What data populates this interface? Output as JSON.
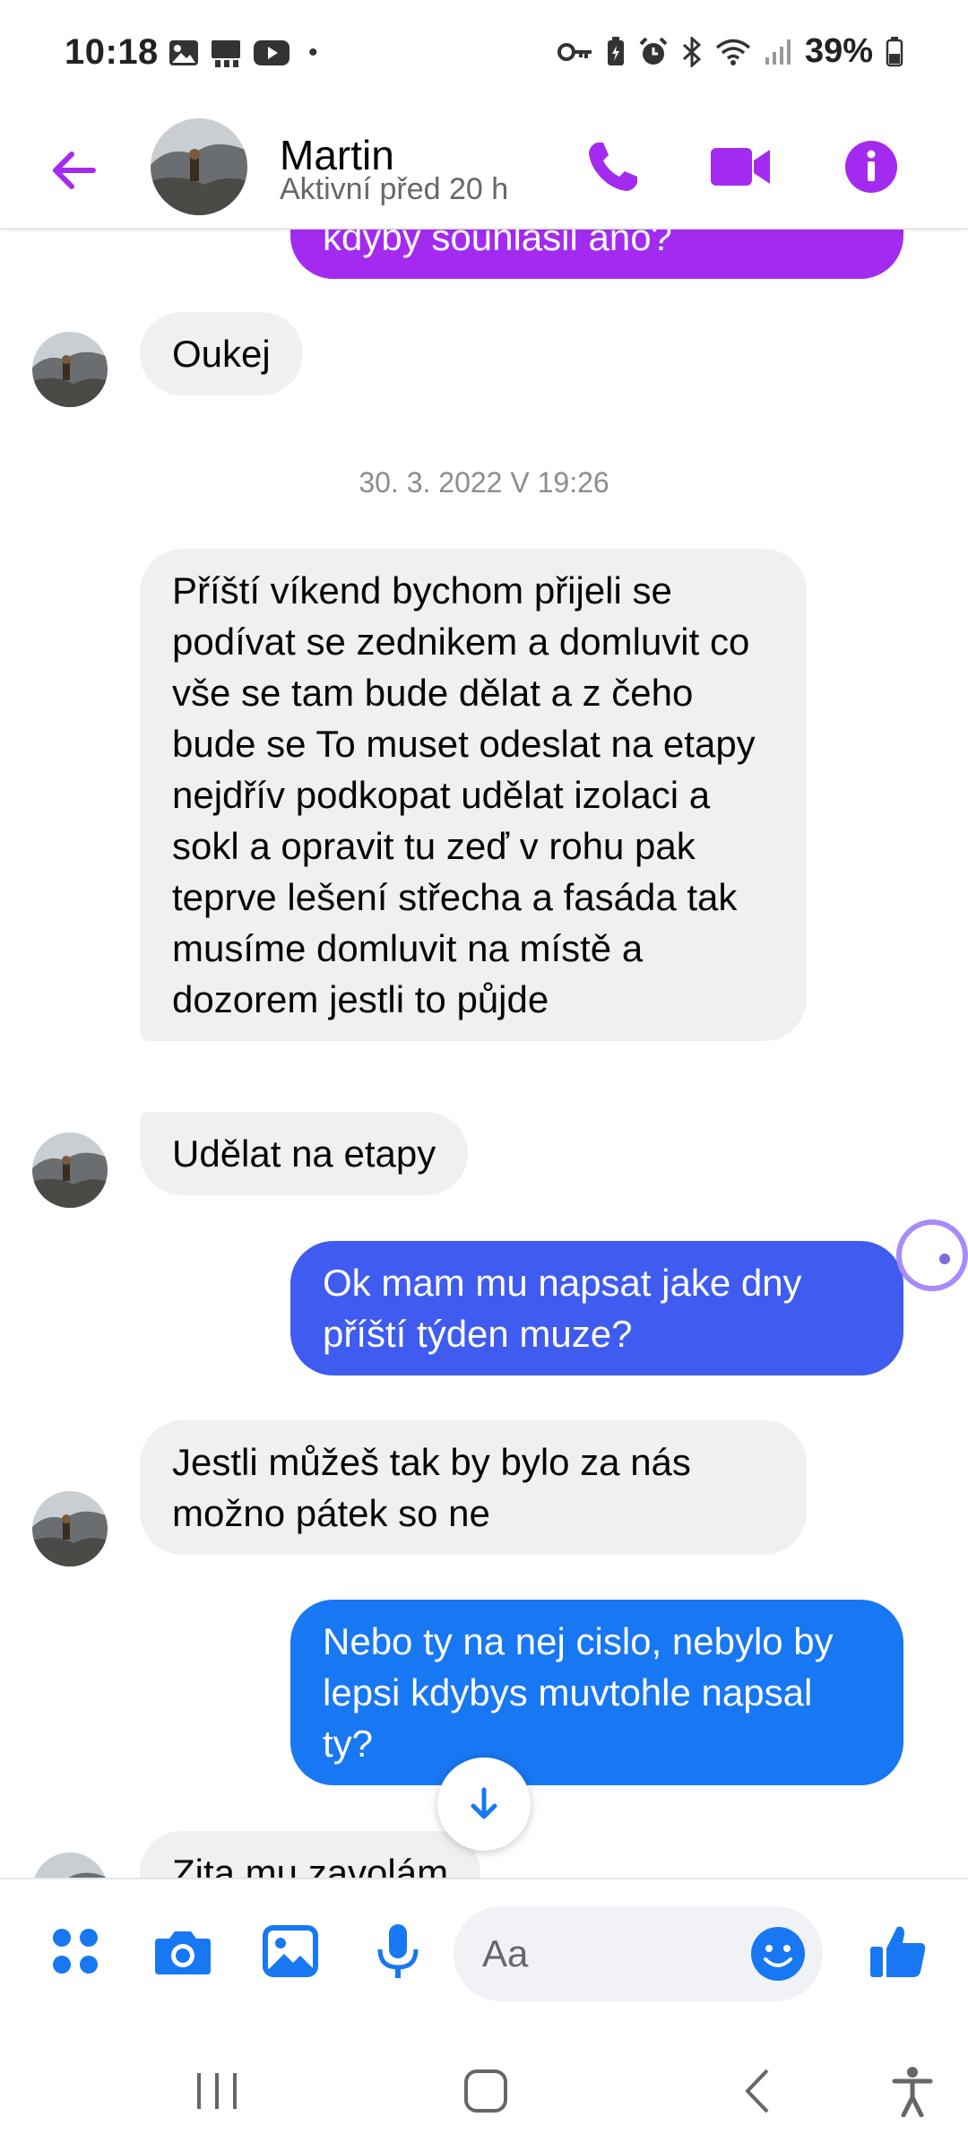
{
  "status_bar": {
    "time": "10:18",
    "dot": "•",
    "battery": "39%"
  },
  "header": {
    "name": "Martin",
    "status": "Aktivní před 20 h"
  },
  "messages": [
    {
      "dir": "out",
      "text": "kdyby souhlasil ano?",
      "color": "#a32bf0"
    },
    {
      "dir": "in",
      "text": "Oukej"
    },
    {
      "dir": "timestamp",
      "text": "30. 3. 2022 V 19:26"
    },
    {
      "dir": "in",
      "text": "Příští víkend bychom přijeli se podívat se zednikem a domluvit co vše se tam bude dělat  a z čeho bude se To muset odeslat na etapy nejdřív podkopat udělat izolaci a sokl a opravit tu zeď v rohu pak teprve lešení střecha a fasáda tak musíme domluvit na místě a dozorem jestli to půjde"
    },
    {
      "dir": "in",
      "text": "Udělat na etapy"
    },
    {
      "dir": "out",
      "text": "Ok mam mu napsat jake dny příští týden muze?",
      "color": "#3f5bf0"
    },
    {
      "dir": "in",
      "text": "Jestli můžeš tak by bylo za nás možno pátek so ne"
    },
    {
      "dir": "out",
      "text": "Nebo ty na nej cislo, nebylo by lepsi kdybys muvtohle napsal ty?",
      "color": "#1877f2"
    },
    {
      "dir": "in",
      "text": "Zita mu zavolám"
    }
  ],
  "composer": {
    "placeholder": "Aa"
  },
  "colors": {
    "accent_header": "#a32bf0",
    "accent_composer": "#1877f2",
    "incoming_bubble": "#f0f0f0"
  },
  "icons": [
    "back-arrow-icon",
    "phone-icon",
    "video-camera-icon",
    "info-icon",
    "apps-grid-icon",
    "camera-icon",
    "gallery-icon",
    "microphone-icon",
    "emoji-icon",
    "thumbs-up-icon",
    "scroll-down-arrow-icon"
  ]
}
